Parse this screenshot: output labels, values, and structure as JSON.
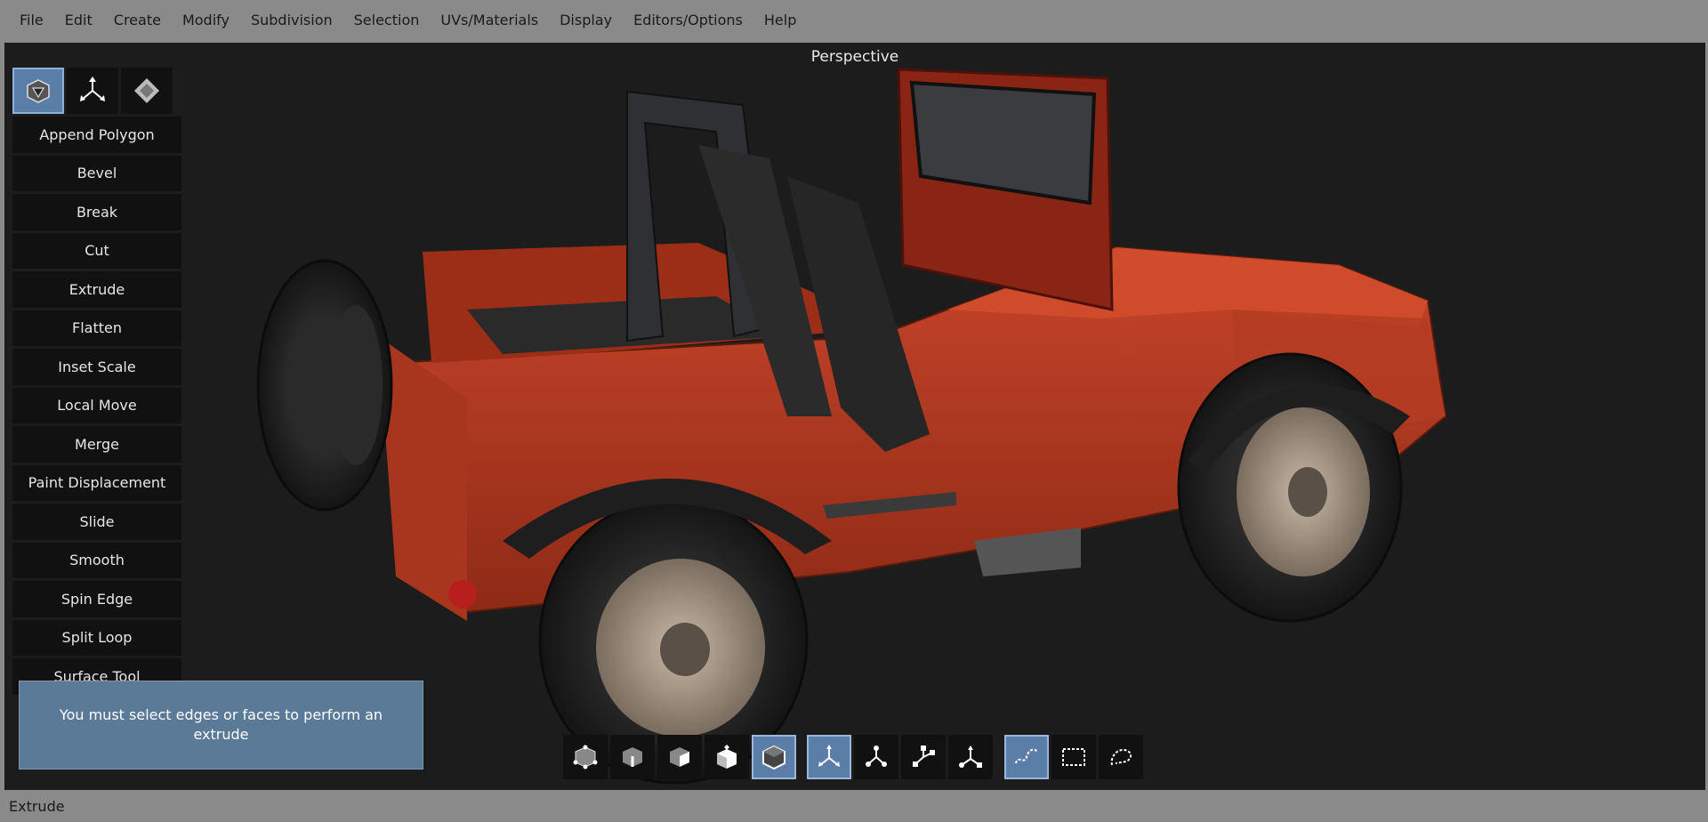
{
  "menu": [
    "File",
    "Edit",
    "Create",
    "Modify",
    "Subdivision",
    "Selection",
    "UVs/Materials",
    "Display",
    "Editors/Options",
    "Help"
  ],
  "viewport": {
    "title": "Perspective"
  },
  "mode_buttons": [
    {
      "icon": "cube-mesh-icon",
      "active": true
    },
    {
      "icon": "transform-gizmo-icon",
      "active": false
    },
    {
      "icon": "uv-diamond-icon",
      "active": false
    }
  ],
  "tools": [
    "Append Polygon",
    "Bevel",
    "Break",
    "Cut",
    "Extrude",
    "Flatten",
    "Inset Scale",
    "Local Move",
    "Merge",
    "Paint Displacement",
    "Slide",
    "Smooth",
    "Spin Edge",
    "Split Loop",
    "Surface Tool"
  ],
  "toast": {
    "message": "You must select edges or faces to perform an extrude"
  },
  "selection_modes": [
    {
      "icon": "vertex-select-icon",
      "active": false
    },
    {
      "icon": "edge-select-icon",
      "active": false
    },
    {
      "icon": "face-select-icon",
      "active": false
    },
    {
      "icon": "uv-select-icon",
      "active": false
    },
    {
      "icon": "object-select-icon",
      "active": true
    }
  ],
  "transform_modes": [
    {
      "icon": "move-gizmo-icon",
      "active": true
    },
    {
      "icon": "rotate-gizmo-icon",
      "active": false
    },
    {
      "icon": "scale-gizmo-icon",
      "active": false
    },
    {
      "icon": "universal-gizmo-icon",
      "active": false
    }
  ],
  "select_tools": [
    {
      "icon": "lasso-select-icon",
      "active": true
    },
    {
      "icon": "rect-select-icon",
      "active": false
    },
    {
      "icon": "freeform-select-icon",
      "active": false
    }
  ],
  "status": {
    "text": "Extrude"
  },
  "colors": {
    "accent": "#5a7ea8",
    "viewport_bg": "#1c1c1c",
    "chrome_bg": "#8a8a8a",
    "vehicle_body": "#b8351d"
  }
}
